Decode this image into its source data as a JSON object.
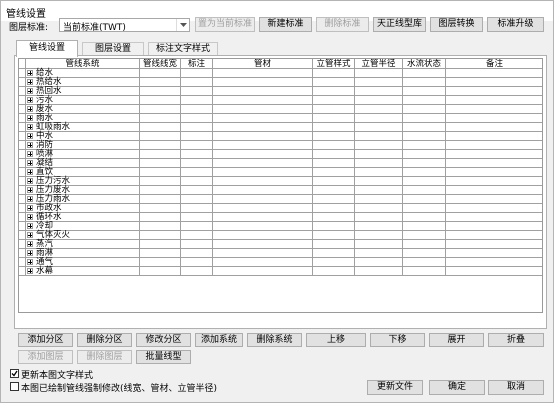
{
  "window": {
    "title": "管线设置"
  },
  "top": {
    "standard_label": "图层标准:",
    "standard_value": "当前标准(TWT)",
    "buttons": [
      "置为当前标准",
      "新建标准",
      "删除标准",
      "天正线型库",
      "图层转换",
      "标准升级"
    ]
  },
  "tabs": [
    "管线设置",
    "图层设置",
    "标注文字样式"
  ],
  "grid": {
    "columns": [
      "管线系统",
      "管线线宽",
      "标注",
      "管材",
      "立管样式",
      "立管半径",
      "水流状态",
      "备注"
    ],
    "rows": [
      "给水",
      "热给水",
      "热回水",
      "污水",
      "废水",
      "雨水",
      "虹吸雨水",
      "中水",
      "消防",
      "喷淋",
      "凝结",
      "直饮",
      "压力污水",
      "压力废水",
      "压力雨水",
      "市政水",
      "循环水",
      "冷却",
      "气体灭火",
      "蒸汽",
      "雨淋",
      "通气",
      "水幕"
    ]
  },
  "buttons_row1": [
    "添加分区",
    "删除分区",
    "修改分区",
    "添加系统",
    "删除系统",
    "上移",
    "下移",
    "展开",
    "折叠"
  ],
  "buttons_row2": [
    "添加图层",
    "删除图层",
    "批量线型"
  ],
  "options": {
    "update_text_style": "更新本图文字样式",
    "force_modify": "本图已绘制管线强制修改(线宽、管材、立管半径)"
  },
  "footer_buttons": [
    "更新文件",
    "确定",
    "取消"
  ]
}
